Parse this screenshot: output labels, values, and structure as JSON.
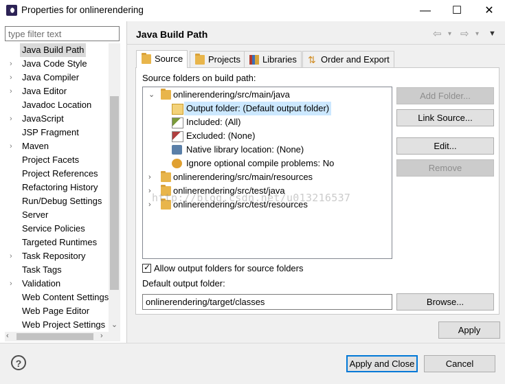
{
  "window": {
    "title": "Properties for onlinerendering",
    "minimize": "—",
    "maximize": "☐",
    "close": "✕"
  },
  "filter": {
    "placeholder": "type filter text"
  },
  "sidebar": {
    "items": [
      {
        "label": "Java Build Path",
        "arrow": "",
        "selected": true
      },
      {
        "label": "Java Code Style",
        "arrow": "›"
      },
      {
        "label": "Java Compiler",
        "arrow": "›"
      },
      {
        "label": "Java Editor",
        "arrow": "›"
      },
      {
        "label": "Javadoc Location",
        "arrow": ""
      },
      {
        "label": "JavaScript",
        "arrow": "›"
      },
      {
        "label": "JSP Fragment",
        "arrow": ""
      },
      {
        "label": "Maven",
        "arrow": "›"
      },
      {
        "label": "Project Facets",
        "arrow": ""
      },
      {
        "label": "Project References",
        "arrow": ""
      },
      {
        "label": "Refactoring History",
        "arrow": ""
      },
      {
        "label": "Run/Debug Settings",
        "arrow": ""
      },
      {
        "label": "Server",
        "arrow": ""
      },
      {
        "label": "Service Policies",
        "arrow": ""
      },
      {
        "label": "Targeted Runtimes",
        "arrow": ""
      },
      {
        "label": "Task Repository",
        "arrow": "›"
      },
      {
        "label": "Task Tags",
        "arrow": ""
      },
      {
        "label": "Validation",
        "arrow": "›"
      },
      {
        "label": "Web Content Settings",
        "arrow": ""
      },
      {
        "label": "Web Page Editor",
        "arrow": ""
      },
      {
        "label": "Web Project Settings",
        "arrow": ""
      }
    ]
  },
  "page": {
    "title": "Java Build Path"
  },
  "tabs": [
    {
      "label": "Source",
      "active": true,
      "icon": "source-icon"
    },
    {
      "label": "Projects",
      "icon": "projects-icon"
    },
    {
      "label": "Libraries",
      "icon": "libraries-icon"
    },
    {
      "label": "Order and Export",
      "icon": "order-export-icon"
    }
  ],
  "source": {
    "label": "Source folders on build path:",
    "tree": [
      {
        "text": "onlinerendering/src/main/java",
        "arrow": "⌄",
        "level": 0,
        "icon": "package-folder-icon"
      },
      {
        "text": "Output folder: (Default output folder)",
        "level": 1,
        "icon": "output-folder-icon",
        "selected": true
      },
      {
        "text": "Included: (All)",
        "level": 1,
        "icon": "included-icon"
      },
      {
        "text": "Excluded: (None)",
        "level": 1,
        "icon": "excluded-icon"
      },
      {
        "text": "Native library location: (None)",
        "level": 1,
        "icon": "native-library-icon"
      },
      {
        "text": "Ignore optional compile problems: No",
        "level": 1,
        "icon": "ignore-problems-icon"
      },
      {
        "text": "onlinerendering/src/main/resources",
        "arrow": "›",
        "level": 0,
        "icon": "package-folder-icon"
      },
      {
        "text": "onlinerendering/src/test/java",
        "arrow": "›",
        "level": 0,
        "icon": "package-folder-icon"
      },
      {
        "text": "onlinerendering/src/test/resources",
        "arrow": "›",
        "level": 0,
        "icon": "package-folder-icon"
      }
    ],
    "buttons": {
      "add_folder": "Add Folder...",
      "link_source": "Link Source...",
      "edit": "Edit...",
      "remove": "Remove"
    },
    "allow_output_label": "Allow output folders for source folders",
    "default_output_label": "Default output folder:",
    "default_output_value": "onlinerendering/target/classes",
    "browse": "Browse..."
  },
  "watermark": "http://blog.csdn.net/u013216537",
  "footer": {
    "apply": "Apply",
    "apply_close": "Apply and Close",
    "cancel": "Cancel",
    "help": "?"
  }
}
